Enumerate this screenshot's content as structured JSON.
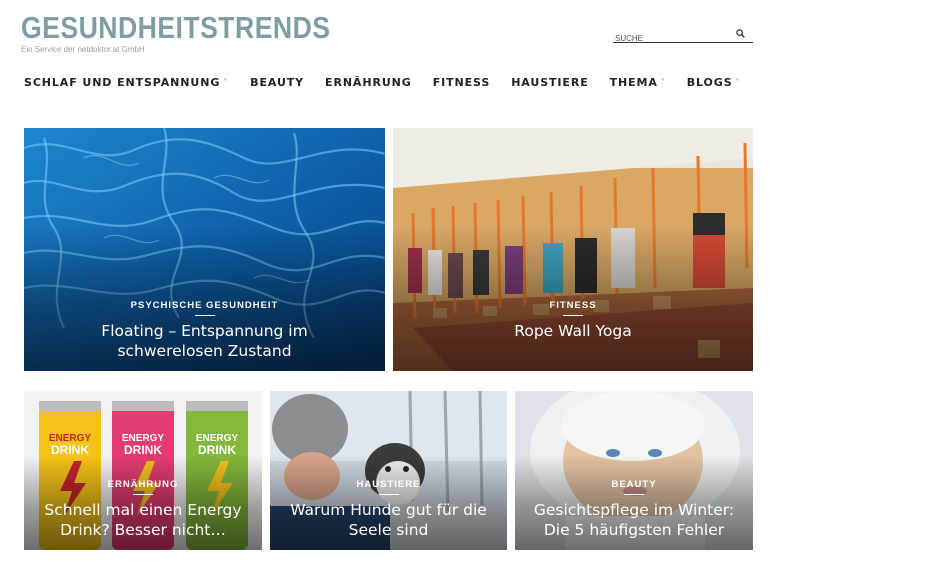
{
  "brand": {
    "title": "GESUNDHEITSTRENDS",
    "subtitle": "Ein Service der netdoktor.at GmbH"
  },
  "search": {
    "placeholder": "SUCHE"
  },
  "nav": [
    {
      "label": "SCHLAF UND ENTSPANNUNG",
      "has_dropdown": true
    },
    {
      "label": "BEAUTY",
      "has_dropdown": false
    },
    {
      "label": "ERNÄHRUNG",
      "has_dropdown": false
    },
    {
      "label": "FITNESS",
      "has_dropdown": false
    },
    {
      "label": "HAUSTIERE",
      "has_dropdown": false
    },
    {
      "label": "THEMA",
      "has_dropdown": true
    },
    {
      "label": "BLOGS",
      "has_dropdown": true
    }
  ],
  "articles": [
    {
      "category": "PSYCHISCHE GESUNDHEIT",
      "title_line1": "Floating – Entspannung im",
      "title_line2": "schwerelosen Zustand",
      "image": "pool-water"
    },
    {
      "category": "FITNESS",
      "title_line1": "Rope Wall Yoga",
      "image": "rope-wall-yoga-class"
    },
    {
      "category": "ERNÄHRUNG",
      "title_line1": "Schnell mal einen Energy",
      "title_line2": "Drink? Besser nicht…",
      "image": "energy-drink-cans",
      "can_lines": [
        "ENERGY",
        "DRINK"
      ]
    },
    {
      "category": "HAUSTIERE",
      "title_line1": "Warum Hunde gut für die",
      "title_line2": "Seele sind",
      "image": "man-with-husky"
    },
    {
      "category": "BEAUTY",
      "title_line1": "Gesichtspflege im Winter:",
      "title_line2": "Die 5 häufigsten Fehler",
      "image": "woman-in-fur-hood"
    }
  ],
  "colors": {
    "logo": "#7f9ea3",
    "nav_text": "#222222",
    "caption_text": "#ffffff"
  }
}
